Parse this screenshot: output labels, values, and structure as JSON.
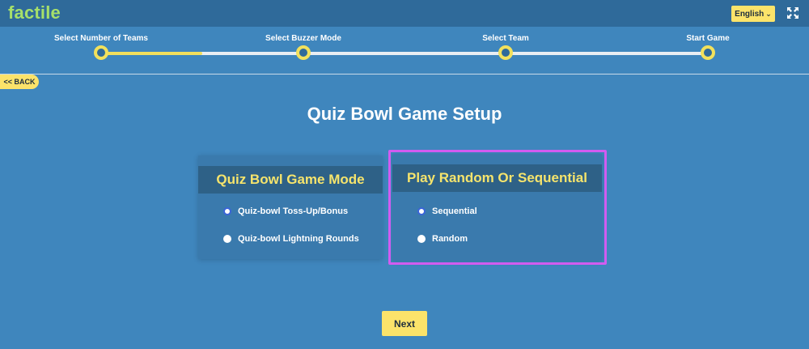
{
  "header": {
    "logo_text": "factile",
    "language_label": "English",
    "language_icon": "chevron-down-icon",
    "fullscreen_icon": "fullscreen-icon"
  },
  "stepper": {
    "steps": [
      {
        "label": "Select Number of Teams"
      },
      {
        "label": "Select Buzzer Mode"
      },
      {
        "label": "Select Team"
      },
      {
        "label": "Start Game"
      }
    ],
    "progress_fraction": 0.167
  },
  "back_label": "<< BACK",
  "page_title": "Quiz Bowl Game Setup",
  "game_mode": {
    "title": "Quiz Bowl Game Mode",
    "options": [
      {
        "label": "Quiz-bowl Toss-Up/Bonus",
        "selected": true
      },
      {
        "label": "Quiz-bowl Lightning Rounds",
        "selected": false
      }
    ]
  },
  "order_mode": {
    "title": "Play Random Or Sequential",
    "options": [
      {
        "label": "Sequential",
        "selected": true
      },
      {
        "label": "Random",
        "selected": false
      }
    ]
  },
  "next_label": "Next",
  "colors": {
    "background": "#3f86bd",
    "header": "#2f6a9a",
    "accent_yellow": "#fbe36a",
    "logo_green": "#a6e06a",
    "highlight": "#d25cf0"
  }
}
